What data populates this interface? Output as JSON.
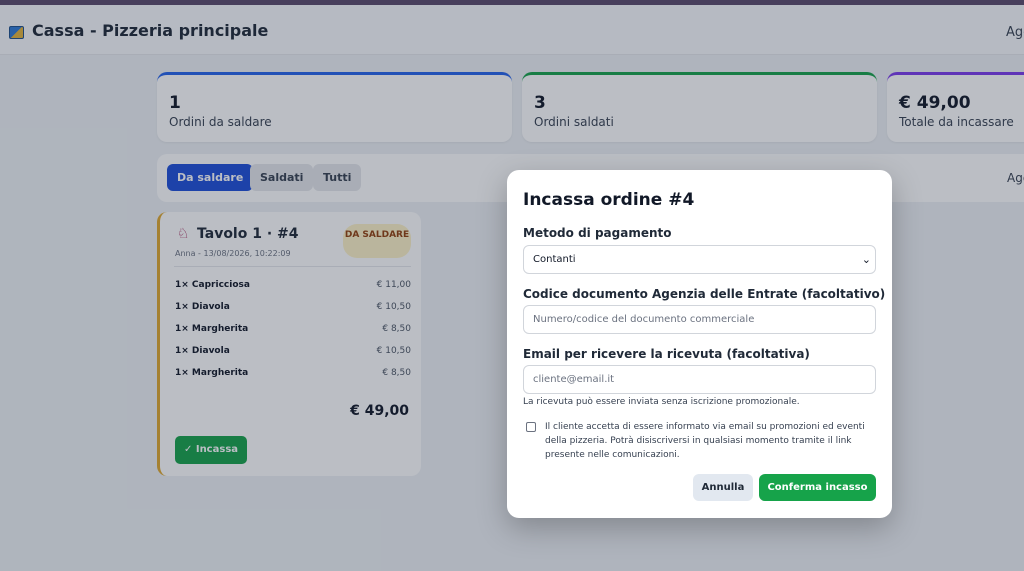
{
  "header": {
    "title": "Cassa - Pizzeria principale",
    "right_text": "Agg"
  },
  "stats": [
    {
      "value": "1",
      "label": "Ordini da saldare"
    },
    {
      "value": "3",
      "label": "Ordini saldati"
    },
    {
      "value": "€ 49,00",
      "label": "Totale da incassare"
    }
  ],
  "filters": {
    "tabs": [
      "Da saldare",
      "Saldati",
      "Tutti"
    ],
    "active": "Da saldare",
    "right_text": "Agg"
  },
  "order": {
    "title": "Tavolo 1 · #4",
    "subtitle": "Anna - 13/08/2026, 10:22:09",
    "badge": "DA SALDARE",
    "items": [
      {
        "name": "1× Capricciosa",
        "price": "€ 11,00"
      },
      {
        "name": "1× Diavola",
        "price": "€ 10,50"
      },
      {
        "name": "1× Margherita",
        "price": "€ 8,50"
      },
      {
        "name": "1× Diavola",
        "price": "€ 10,50"
      },
      {
        "name": "1× Margherita",
        "price": "€ 8,50"
      }
    ],
    "total": "€ 49,00",
    "incassa_label": "✓ Incassa"
  },
  "modal": {
    "title": "Incassa ordine #4",
    "payment_label": "Metodo di pagamento",
    "payment_value": "Contanti",
    "doc_label": "Codice documento Agenzia delle Entrate (facoltativo)",
    "doc_placeholder": "Numero/codice del documento commerciale",
    "email_label": "Email per ricevere la ricevuta (facoltativa)",
    "email_placeholder": "cliente@email.it",
    "note": "La ricevuta può essere inviata senza iscrizione promozionale.",
    "consent": "Il cliente accetta di essere informato via email su promozioni ed eventi della pizzeria. Potrà disiscriversi in qualsiasi momento tramite il link presente nelle comunicazioni.",
    "cancel_label": "Annulla",
    "confirm_label": "Conferma incasso"
  },
  "colors": {
    "primary": "#1d4ed8",
    "success": "#16a34a",
    "warning": "#e0a82e",
    "purple": "#7c3aed"
  }
}
